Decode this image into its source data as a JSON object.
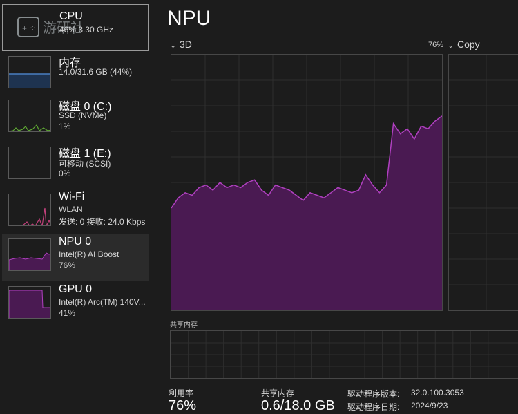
{
  "sidebar": {
    "items": [
      {
        "name": "CPU",
        "sub1": "46% 3.30 GHz",
        "sub2": ""
      },
      {
        "name": "内存",
        "sub1": "14.0/31.6 GB (44%)",
        "sub2": ""
      },
      {
        "name": "磁盘 0 (C:)",
        "sub1": "SSD (NVMe)",
        "sub2": "1%"
      },
      {
        "name": "磁盘 1 (E:)",
        "sub1": "可移动 (SCSI)",
        "sub2": "0%"
      },
      {
        "name": "Wi-Fi",
        "sub1": "WLAN",
        "sub2": "发送: 0 接收: 24.0 Kbps"
      },
      {
        "name": "NPU 0",
        "sub1": "Intel(R) AI Boost",
        "sub2": "76%"
      },
      {
        "name": "GPU 0",
        "sub1": "Intel(R) Arc(TM) 140V...",
        "sub2": "41%"
      }
    ]
  },
  "main": {
    "title": "NPU",
    "graph1_label": "3D",
    "graph1_pct": "76%",
    "graph2_label": "Copy",
    "shared_mem_label": "共享内存",
    "stats": {
      "util_label": "利用率",
      "util_value": "76%",
      "shared_label": "共享内存",
      "shared_value": "0.6/18.0 GB"
    },
    "details": {
      "driver_version_label": "驱动程序版本:",
      "driver_version": "32.0.100.3053",
      "driver_date_label": "驱动程序日期:",
      "driver_date": "2024/9/23"
    }
  },
  "colors": {
    "accent_npu": "#b040c0",
    "fill_npu": "#4a1a52",
    "memory": "#4a7fc1",
    "disk": "#5ea832",
    "wifi": "#c0407a"
  },
  "chart_data": {
    "type": "area",
    "title": "3D",
    "ylim": [
      0,
      100
    ],
    "values": [
      40,
      44,
      46,
      45,
      48,
      49,
      47,
      50,
      48,
      49,
      48,
      50,
      51,
      47,
      45,
      49,
      48,
      47,
      45,
      43,
      46,
      45,
      44,
      46,
      48,
      47,
      46,
      47,
      53,
      49,
      46,
      49,
      73,
      69,
      71,
      67,
      72,
      71,
      74,
      76
    ]
  }
}
